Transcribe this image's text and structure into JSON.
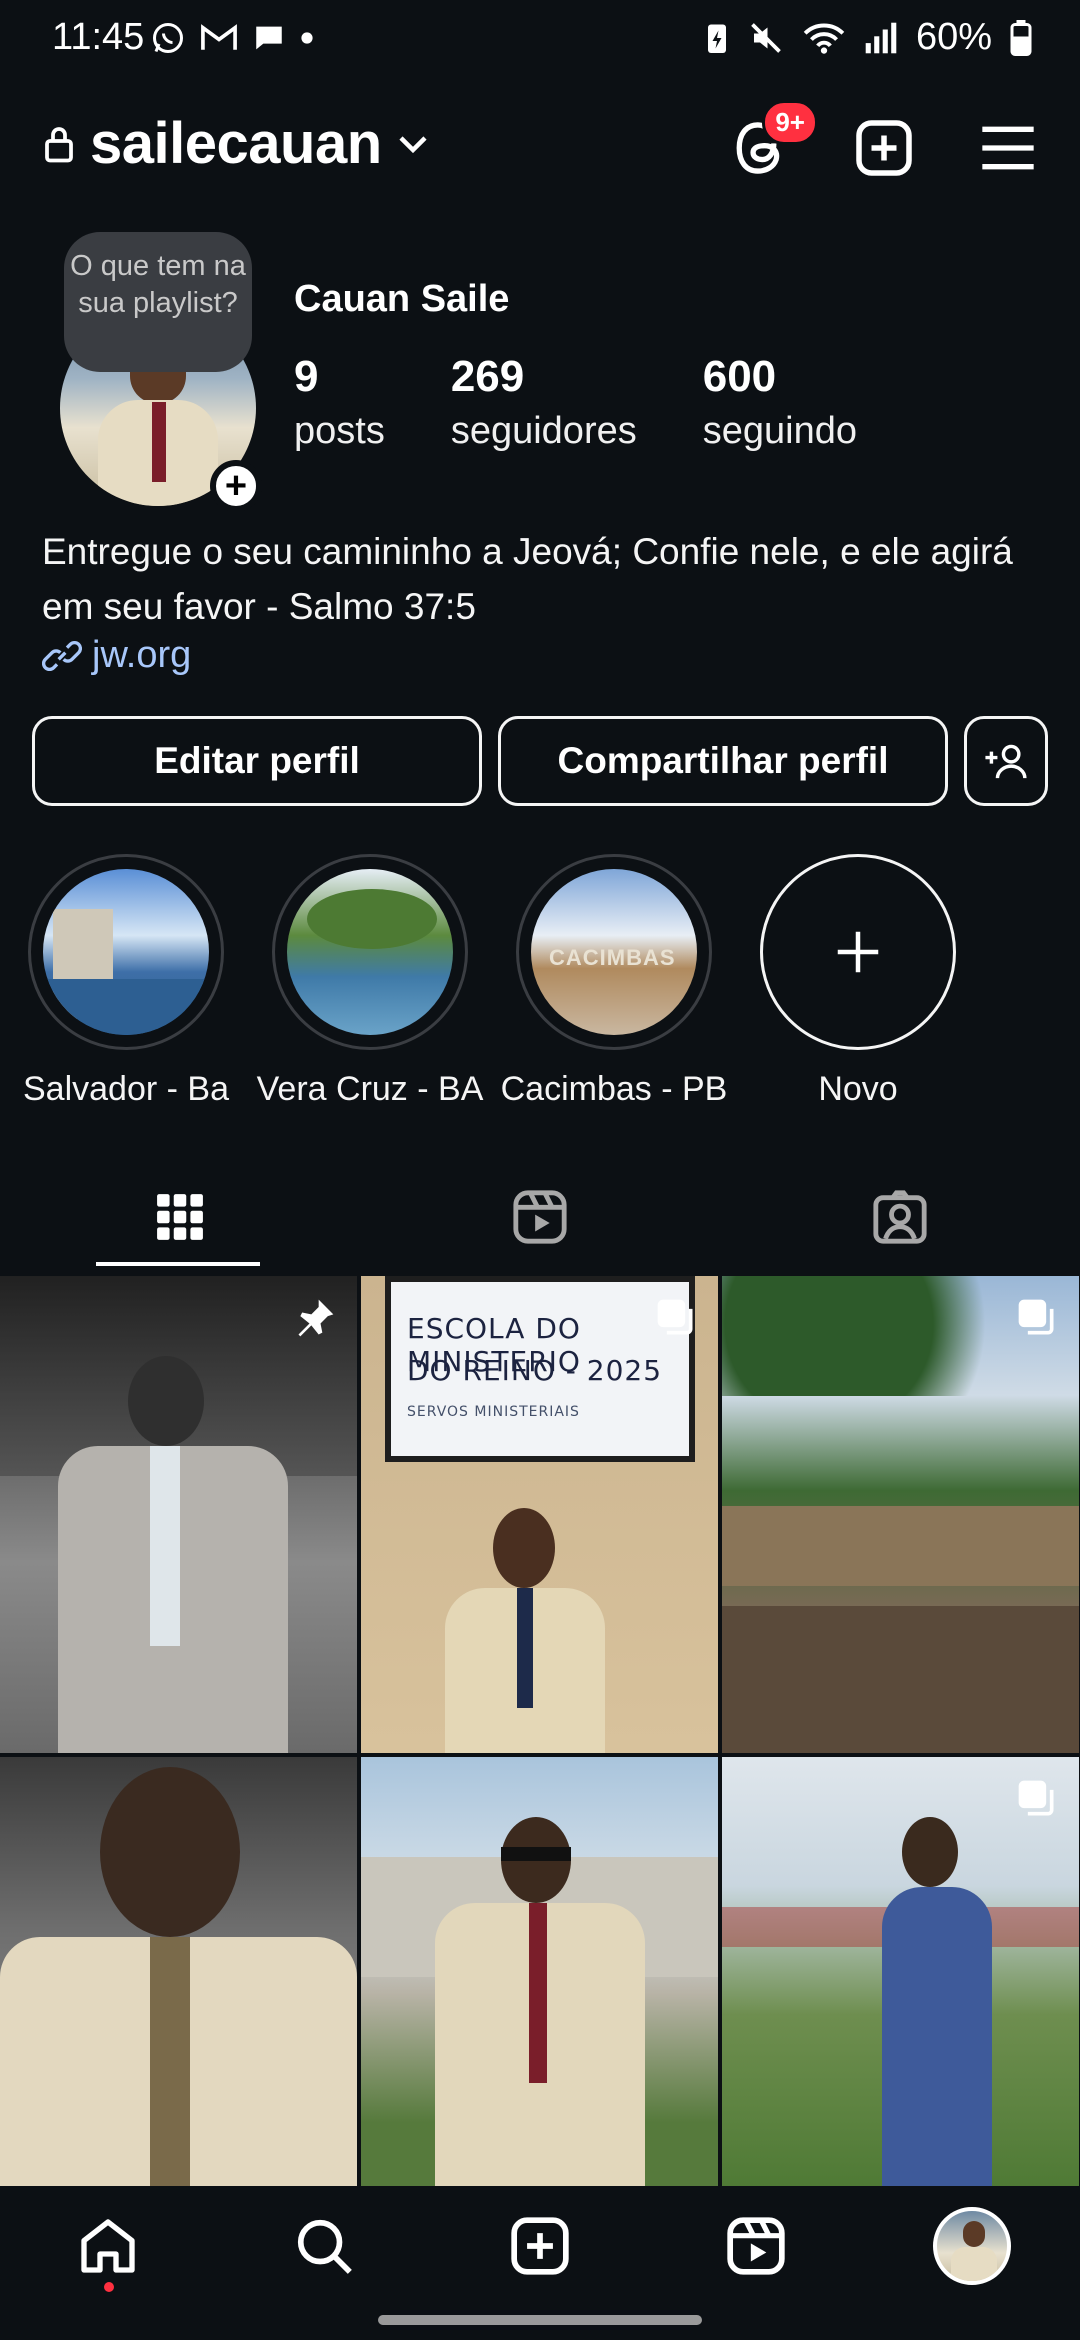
{
  "status_bar": {
    "time": "11:45",
    "battery": "60%",
    "left_icons": [
      "whatsapp-icon",
      "gmail-icon",
      "messages-icon",
      "dot-icon"
    ],
    "right_icons": [
      "battery-saver-icon",
      "mute-icon",
      "wifi-icon",
      "signal-icon",
      "battery-icon"
    ]
  },
  "header": {
    "username": "sailecauan",
    "threads_badge": "9+",
    "accent_badge_color": "#ff3040"
  },
  "profile": {
    "note_text": "O que tem na sua playlist?",
    "display_name": "Cauan Saile",
    "stats": [
      {
        "value": "9",
        "label": "posts"
      },
      {
        "value": "269",
        "label": "seguidores"
      },
      {
        "value": "600",
        "label": "seguindo"
      }
    ],
    "bio": "Entregue o seu camininho a Jeová; Confie nele, e ele agirá em seu favor - Salmo 37:5",
    "link": "jw.org",
    "link_color": "#a8c7fa"
  },
  "actions": {
    "edit_profile": "Editar perfil",
    "share_profile": "Compartilhar perfil"
  },
  "highlights": [
    {
      "label": "Salvador - Ba"
    },
    {
      "label": "Vera Cruz - BA"
    },
    {
      "label": "Cacimbas - PB"
    },
    {
      "label": "Novo"
    }
  ],
  "cacimbas_overlay_text": "CACIMBAS",
  "tabs": [
    "posts-grid-icon",
    "reels-icon",
    "tagged-icon"
  ],
  "posts": {
    "sign_line1": "ESCOLA DO MINISTERIO",
    "sign_line2": "DO REINO - 2025",
    "sign_line3": "SERVOS MINISTERIAIS"
  },
  "bottom_nav": [
    "home-icon",
    "search-icon",
    "create-icon",
    "reels-icon",
    "profile-avatar"
  ]
}
